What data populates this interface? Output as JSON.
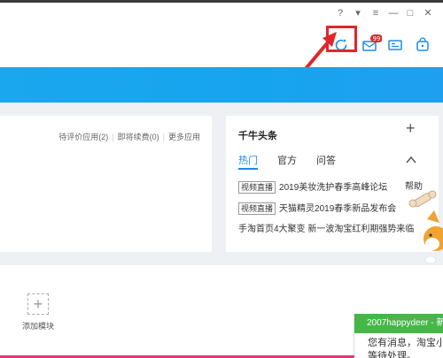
{
  "window": {
    "controls": [
      "?",
      "▾",
      "≡",
      "—",
      "□",
      "✕"
    ]
  },
  "header": {
    "message_badge": "99"
  },
  "apps_card": {
    "links": [
      "待评价应用(2)",
      "即将续费(0)",
      "更多应用"
    ]
  },
  "news_card": {
    "title": "千牛头条",
    "plus": "+",
    "tabs": [
      "热门",
      "官方",
      "问答"
    ],
    "items": [
      {
        "tag": "视频直播",
        "text": "2019美妆洗护春季高峰论坛"
      },
      {
        "tag": "视频直播",
        "text": "天猫精灵2019春季新品发布会"
      },
      {
        "tag": "",
        "text": "手淘首页4大聚变 新一波淘宝红利期强势来临"
      }
    ]
  },
  "help_label": "帮助",
  "add_module": {
    "icon": "+",
    "label": "添加模块"
  },
  "toast": {
    "title": "2007happydeer - 新",
    "line1": "您有消息，淘宝小",
    "line2": "等待处理。"
  },
  "colors": {
    "banner": "#1aa7ee",
    "highlight": "#e0262b",
    "tab_active": "#1b8bea",
    "toast_header": "#47b649"
  }
}
